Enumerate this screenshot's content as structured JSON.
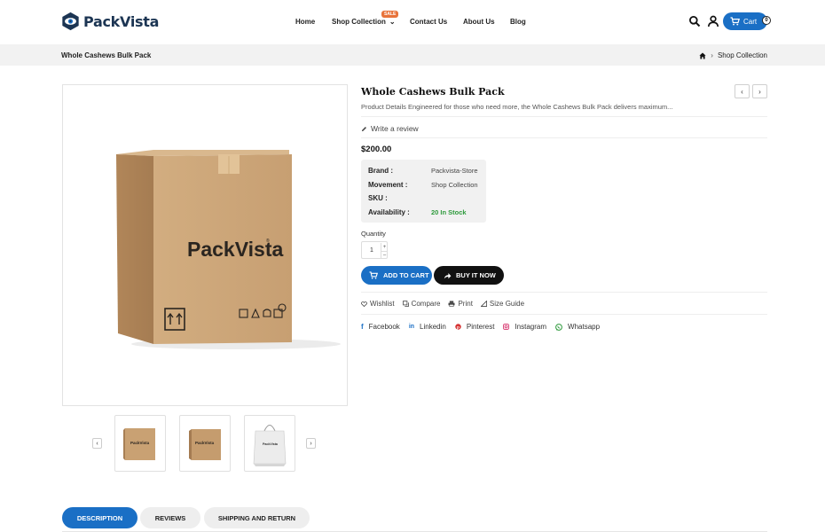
{
  "header": {
    "logo_text": "PackVista",
    "nav": [
      {
        "label": "Home"
      },
      {
        "label": "Shop Collection",
        "badge": "SALE"
      },
      {
        "label": "Contact Us"
      },
      {
        "label": "About Us"
      },
      {
        "label": "Blog"
      }
    ],
    "icons": [
      "search-icon",
      "user-icon",
      "cart-icon"
    ],
    "cart_label": "Cart",
    "cart_count": "0"
  },
  "breadcrumb": {
    "page_title": "Whole Cashews Bulk Pack",
    "trail": [
      "Shop Collection"
    ]
  },
  "gallery": {
    "box_brand": "PackVista",
    "thumbnails": [
      "box-front",
      "box-angle",
      "shopping-bag"
    ]
  },
  "product": {
    "title": "Whole Cashews Bulk Pack",
    "description": "Product Details Engineered for those who need more, the Whole Cashews Bulk Pack delivers maximum...",
    "write_review": "Write a review",
    "price": "$200.00",
    "specs": [
      {
        "key": "Brand :",
        "value": "Packvista-Store"
      },
      {
        "key": "Movement :",
        "value": "Shop Collection"
      },
      {
        "key": "SKU :",
        "value": ""
      },
      {
        "key": "Availability :",
        "value": "20 In Stock"
      }
    ],
    "quantity_label": "Quantity",
    "quantity_value": "1",
    "add_to_cart": "ADD TO CART",
    "buy_now": "BUY IT NOW",
    "actions": [
      "Wishlist",
      "Compare",
      "Print",
      "Size Guide"
    ],
    "social": [
      "Facebook",
      "Linkedin",
      "Pinterest",
      "Instagram",
      "Whatsapp"
    ]
  },
  "tabs": [
    {
      "label": "DESCRIPTION",
      "active": true
    },
    {
      "label": "REVIEWS",
      "active": false
    },
    {
      "label": "SHIPPING AND RETURN",
      "active": false
    }
  ],
  "colors": {
    "accent": "#1a6fc5",
    "brand_dark": "#1c3553",
    "in_stock": "#2e9a3c"
  }
}
